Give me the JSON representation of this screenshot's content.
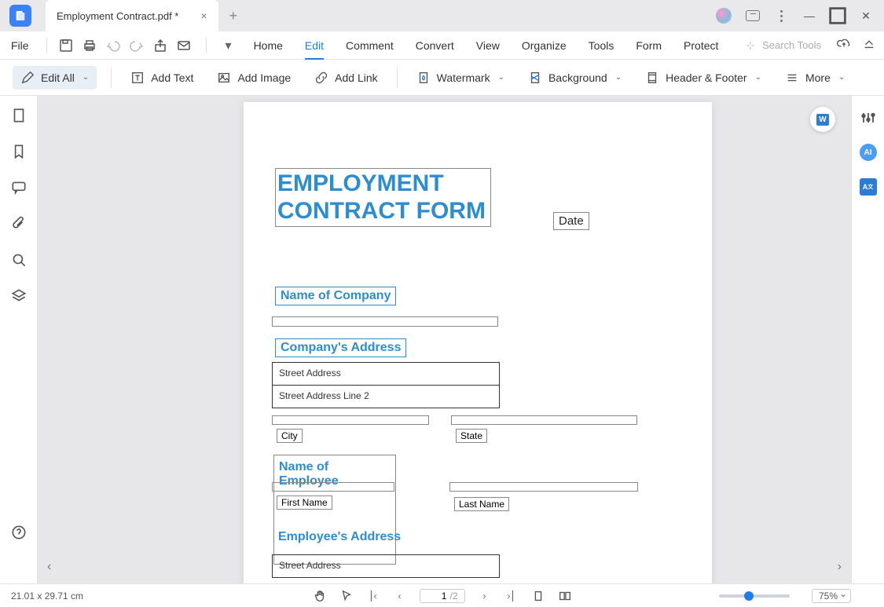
{
  "titlebar": {
    "tab_name": "Employment Contract.pdf *"
  },
  "menubar": {
    "file": "File",
    "tabs": {
      "home": "Home",
      "edit": "Edit",
      "comment": "Comment",
      "convert": "Convert",
      "view": "View",
      "organize": "Organize",
      "tools": "Tools",
      "form": "Form",
      "protect": "Protect"
    },
    "search_placeholder": "Search Tools"
  },
  "ribbon": {
    "edit_all": "Edit All",
    "add_text": "Add Text",
    "add_image": "Add Image",
    "add_link": "Add Link",
    "watermark": "Watermark",
    "background": "Background",
    "header_footer": "Header & Footer",
    "more": "More"
  },
  "document": {
    "title_line1": "EMPLOYMENT",
    "title_line2": "CONTRACT FORM",
    "date_label": "Date",
    "company_label": "Name of Company",
    "company_addr_label": "Company's Address",
    "street1": "Street Address",
    "street2": "Street Address Line 2",
    "city": "City",
    "state": "State",
    "employee_label": "Name of Employee",
    "first_name": "First Name",
    "last_name": "Last Name",
    "employee_addr_label": "Employee's Address",
    "emp_street1": "Street Address"
  },
  "status": {
    "dimensions": "21.01 x 29.71 cm",
    "page_current": "1",
    "page_total": "/2",
    "zoom": "75%"
  },
  "right_panel": {
    "ai": "AI",
    "translate": "A+"
  }
}
